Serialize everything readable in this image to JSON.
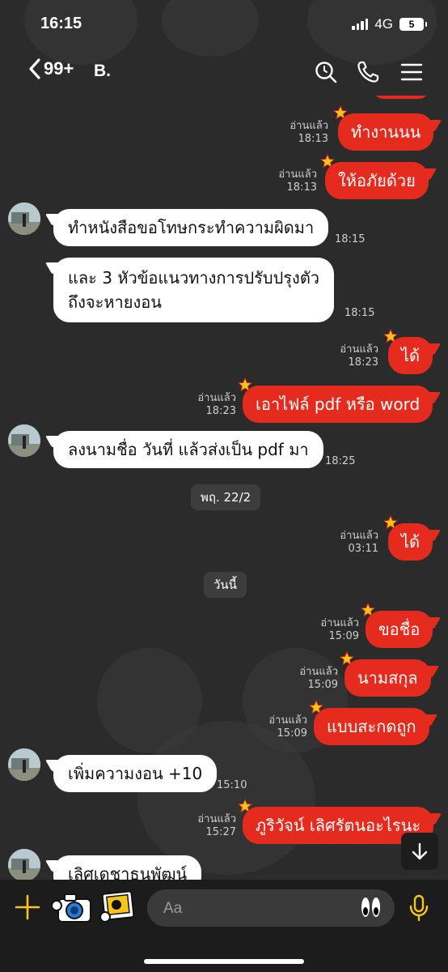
{
  "status": {
    "time": "16:15",
    "network": "4G",
    "battery": "5"
  },
  "nav": {
    "back_count": "99+",
    "title": "B."
  },
  "messages": [
    {
      "id": "m1",
      "dir": "out",
      "text": "ทำงานนน",
      "read": "อ่านแล้ว",
      "time": "18:13"
    },
    {
      "id": "m2",
      "dir": "out",
      "text": "ให้อภัยด้วย",
      "read": "อ่านแล้ว",
      "time": "18:13"
    },
    {
      "id": "m3",
      "dir": "in",
      "text": "ทำหนังสือขอโทษกระทำความผิดมา",
      "time": "18:15"
    },
    {
      "id": "m4",
      "dir": "in",
      "lines": [
        "และ 3 หัวข้อแนวทางการปรับปรุงตัว",
        "ถึงจะหายงอน"
      ],
      "time": "18:15"
    },
    {
      "id": "m5",
      "dir": "out",
      "text": "ได้",
      "read": "อ่านแล้ว",
      "time": "18:23"
    },
    {
      "id": "m6",
      "dir": "out",
      "text": "เอาไฟล์ pdf หรือ word",
      "read": "อ่านแล้ว",
      "time": "18:23"
    },
    {
      "id": "m7",
      "dir": "in",
      "text": "ลงนามชื่อ วันที่ แล้วส่งเป็น pdf มา",
      "time": "18:25"
    },
    {
      "id": "m8",
      "dir": "out",
      "text": "ได้",
      "read": "อ่านแล้ว",
      "time": "03:11"
    },
    {
      "id": "m9",
      "dir": "out",
      "text": "ขอชื่อ",
      "read": "อ่านแล้ว",
      "time": "15:09"
    },
    {
      "id": "m10",
      "dir": "out",
      "text": "นามสกุล",
      "read": "อ่านแล้ว",
      "time": "15:09"
    },
    {
      "id": "m11",
      "dir": "out",
      "text": "แบบสะกดถูก",
      "read": "อ่านแล้ว",
      "time": "15:09"
    },
    {
      "id": "m12",
      "dir": "in",
      "text": "เพิ่มความงอน +10",
      "time": "15:10"
    },
    {
      "id": "m13",
      "dir": "out",
      "text": "ภูริวัจน์ เลิศรัตนอะไรนะ",
      "read": "อ่านแล้ว",
      "time": "15:27"
    },
    {
      "id": "m14",
      "dir": "in",
      "text": "เลิศเดชาธนพัฒน์"
    }
  ],
  "date_separators": {
    "d1": "พฤ. 22/2",
    "d2": "วันนี้"
  },
  "input": {
    "placeholder": "Aa"
  },
  "colors": {
    "outgoing": "#e52b1e",
    "incoming": "#ffffff",
    "background": "#2b2b2b",
    "accent": "#f5c518"
  }
}
